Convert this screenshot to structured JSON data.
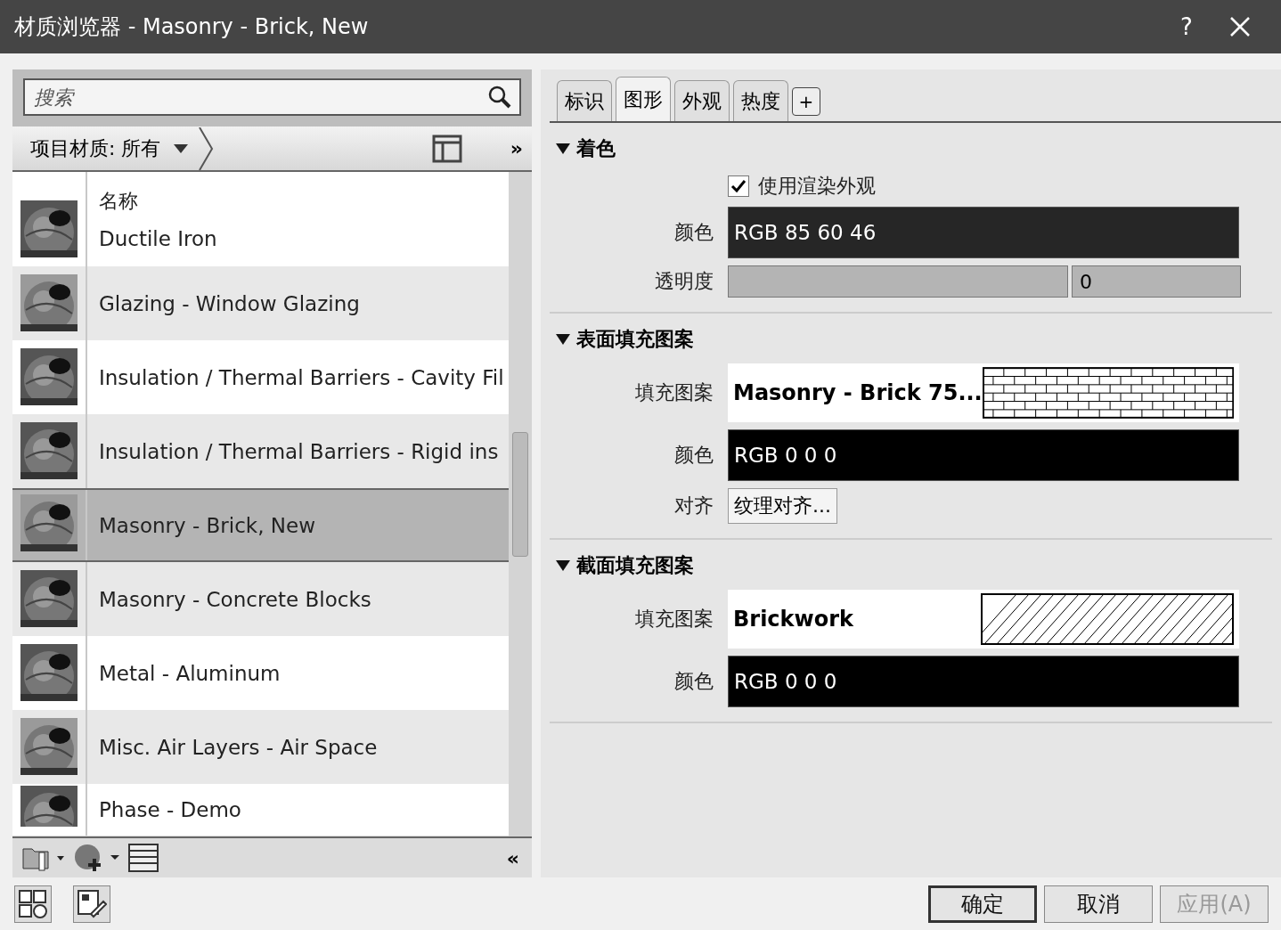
{
  "window": {
    "title": "材质浏览器 - Masonry - Brick, New",
    "help": "?"
  },
  "search": {
    "placeholder": "搜索"
  },
  "library_bar": {
    "label": "项目材质: 所有",
    "more": "»"
  },
  "materials": {
    "column": "名称",
    "rows": [
      {
        "name": "Ductile Iron",
        "selected": false,
        "kind": "picture"
      },
      {
        "name": "Glazing - Window Glazing",
        "selected": false,
        "kind": "picture"
      },
      {
        "name": "Insulation / Thermal Barriers - Cavity Fil",
        "selected": false,
        "kind": "picture"
      },
      {
        "name": "Insulation / Thermal Barriers - Rigid ins",
        "selected": false,
        "kind": "picture"
      },
      {
        "name": "Masonry - Brick, New",
        "selected": true,
        "kind": "picture"
      },
      {
        "name": "Masonry - Concrete Blocks",
        "selected": false,
        "kind": "picture"
      },
      {
        "name": "Metal - Aluminum",
        "selected": false,
        "kind": "picture"
      },
      {
        "name": "Misc. Air Layers - Air Space",
        "selected": false,
        "kind": "picture"
      },
      {
        "name": "Phase - Demo",
        "selected": false,
        "kind": "picture"
      }
    ]
  },
  "left_toolbar": {
    "collapse": "«"
  },
  "tabs": [
    {
      "label": "标识",
      "selected": false
    },
    {
      "label": "图形",
      "selected": true
    },
    {
      "label": "外观",
      "selected": false
    },
    {
      "label": "热度",
      "selected": false
    }
  ],
  "add_tab": "+",
  "sections": [
    {
      "title": "着色",
      "expanded": true,
      "fields": [
        {
          "kind": "checkbox",
          "label": "使用渲染外观",
          "checked": true
        },
        {
          "kind": "color",
          "label": "颜色",
          "value": "RGB 85 60 46",
          "color": "#262626"
        },
        {
          "kind": "slider",
          "label": "透明度",
          "level": 0,
          "reading": "0"
        }
      ]
    },
    {
      "title": "表面填充图案",
      "expanded": true,
      "fields": [
        {
          "kind": "brickpattern",
          "label": "填充图案",
          "value": "Masonry - Brick 75..."
        },
        {
          "kind": "color",
          "label": "颜色",
          "value": "RGB 0 0 0",
          "color": "#000000"
        },
        {
          "kind": "button",
          "label": "对齐",
          "value": "纹理对齐..."
        }
      ]
    },
    {
      "title": "截面填充图案",
      "expanded": true,
      "fields": [
        {
          "kind": "hatchpattern",
          "label": "填充图案",
          "value": "Brickwork"
        },
        {
          "kind": "color",
          "label": "颜色",
          "value": "RGB 0 0 0",
          "color": "#000000"
        }
      ]
    }
  ],
  "buttons": [
    {
      "label": "确定",
      "default": true,
      "disabled": false
    },
    {
      "label": "取消",
      "default": false,
      "disabled": false
    },
    {
      "label": "应用(A)",
      "default": false,
      "disabled": true
    }
  ]
}
